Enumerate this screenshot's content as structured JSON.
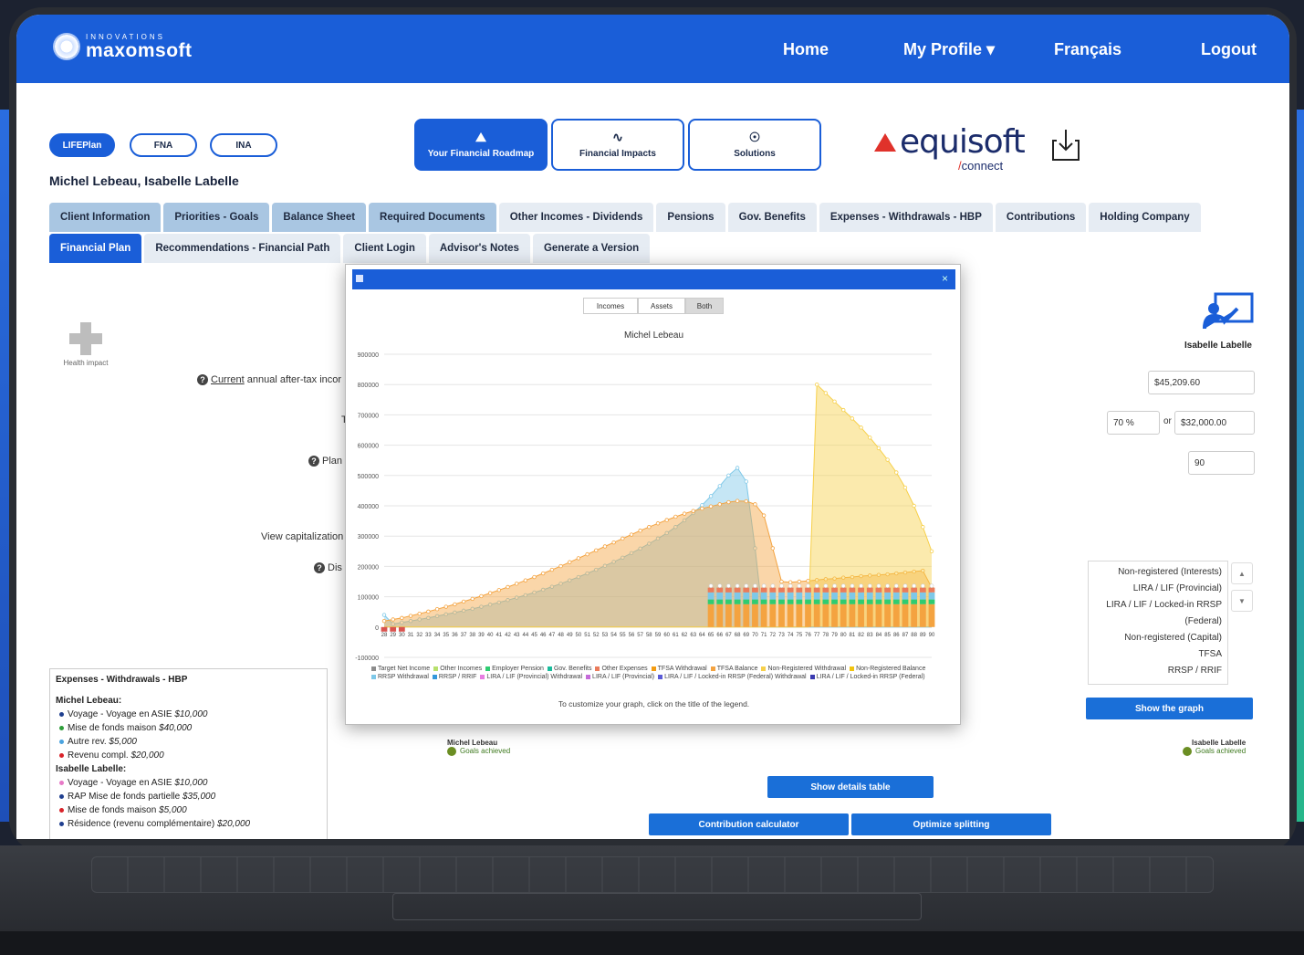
{
  "brand": {
    "small": "INNOVATIONS",
    "name": "maxomsoft"
  },
  "nav": {
    "home": "Home",
    "profile": "My Profile ▾",
    "lang": "Français",
    "logout": "Logout"
  },
  "pills": [
    "LIFEPlan",
    "FNA",
    "INA"
  ],
  "bigtabs": [
    {
      "label": "Your Financial Roadmap",
      "icon": "roadmap-icon"
    },
    {
      "label": "Financial Impacts",
      "icon": "impacts-icon"
    },
    {
      "label": "Solutions",
      "icon": "lightbulb-icon"
    }
  ],
  "equisoft": {
    "name": "equisoft",
    "slash": "/",
    "sub": "connect"
  },
  "client_name": "Michel Lebeau, Isabelle Labelle",
  "tabs_row1": [
    "Client Information",
    "Priorities - Goals",
    "Balance Sheet",
    "Required Documents",
    "Other Incomes - Dividends",
    "Pensions",
    "Gov. Benefits",
    "Expenses - Withdrawals - HBP",
    "Contributions",
    "Holding Company"
  ],
  "tabs_row2": [
    "Financial Plan",
    "Recommendations - Financial Path",
    "Client Login",
    "Advisor's Notes",
    "Generate a Version"
  ],
  "health": "Health impact",
  "labels": {
    "current": "Current",
    "current_rest": " annual after-tax incor",
    "t": "T",
    "plan": "Plan",
    "view_cap": "View capitalization",
    "dis": "Dis"
  },
  "right_panel": {
    "name": "Isabelle Labelle",
    "income": "$45,209.60",
    "pct": "70 %",
    "or": "or",
    "amount": "$32,000.00",
    "age": "90",
    "list": [
      "Non-registered (Interests)",
      "LIRA / LIF (Provincial)",
      "LIRA / LIF / Locked-in RRSP",
      "(Federal)",
      "Non-registered (Capital)",
      "TFSA",
      "RRSP / RRIF"
    ],
    "up": "▲",
    "down": "▼",
    "show_graph": "Show the graph"
  },
  "goals": {
    "michel": "Michel Lebeau",
    "isabelle": "Isabelle Labelle",
    "achieved": "Goals achieved"
  },
  "buttons": {
    "details": "Show details table",
    "contrib": "Contribution calculator",
    "split": "Optimize splitting"
  },
  "expenses": {
    "title": "Expenses - Withdrawals - HBP",
    "michel_label": "Michel Lebeau:",
    "michel": [
      {
        "t": "Voyage - Voyage en ASIE ",
        "v": "$10,000",
        "c": "#1f3f8f"
      },
      {
        "t": "Mise de fonds maison ",
        "v": "$40,000",
        "c": "#2e9e3a"
      },
      {
        "t": "Autre rev. ",
        "v": "$5,000",
        "c": "#4aa3df"
      },
      {
        "t": "Revenu compl. ",
        "v": "$20,000",
        "c": "#d9232a"
      }
    ],
    "isabelle_label": "Isabelle Labelle:",
    "isabelle": [
      {
        "t": "Voyage - Voyage en ASIE ",
        "v": "$10,000",
        "c": "#e77ac7"
      },
      {
        "t": "RAP Mise de fonds partielle ",
        "v": "$35,000",
        "c": "#1f3f8f"
      },
      {
        "t": "Mise de fonds maison ",
        "v": "$5,000",
        "c": "#d9232a"
      },
      {
        "t": "Résidence (revenu complémentaire) ",
        "v": "$20,000",
        "c": "#1f3f8f"
      }
    ]
  },
  "modal": {
    "segs": [
      "Incomes",
      "Assets",
      "Both"
    ],
    "selected": "Both",
    "tip": "To customize your graph, click on the title of the legend."
  },
  "chart_data": {
    "type": "area",
    "title": "Michel Lebeau",
    "ylim": [
      -100000,
      900000
    ],
    "yticks": [
      -100000,
      0,
      100000,
      200000,
      300000,
      400000,
      500000,
      600000,
      700000,
      800000,
      900000
    ],
    "x": [
      28,
      29,
      30,
      31,
      32,
      33,
      34,
      35,
      36,
      37,
      38,
      39,
      40,
      41,
      42,
      43,
      44,
      45,
      46,
      47,
      48,
      49,
      50,
      51,
      52,
      53,
      54,
      55,
      56,
      57,
      58,
      59,
      60,
      61,
      62,
      63,
      64,
      65,
      66,
      67,
      68,
      69,
      70,
      71,
      72,
      73,
      74,
      75,
      76,
      77,
      78,
      79,
      80,
      81,
      82,
      83,
      84,
      85,
      86,
      87,
      88,
      89,
      90
    ],
    "series": [
      {
        "name": "RRSP Withdrawal",
        "color": "#7ec8e8",
        "values": [
          40000,
          10000,
          15000,
          20000,
          25000,
          30000,
          36000,
          42000,
          48000,
          54000,
          60000,
          67000,
          74000,
          81000,
          89000,
          97000,
          105000,
          114000,
          123000,
          133000,
          143000,
          154000,
          165000,
          177000,
          189000,
          202000,
          215000,
          229000,
          244000,
          259000,
          275000,
          292000,
          310000,
          330000,
          352000,
          376000,
          402000,
          432000,
          465000,
          500000,
          525000,
          480000,
          260000,
          0,
          0,
          0,
          0,
          0,
          0,
          0,
          0,
          0,
          0,
          0,
          0,
          0,
          0,
          0,
          0,
          0,
          0,
          0,
          0
        ]
      },
      {
        "name": "TFSA Balance",
        "color": "#f4a340",
        "values": [
          20000,
          25000,
          30000,
          37000,
          44000,
          51000,
          59000,
          67000,
          75000,
          84000,
          93000,
          102000,
          112000,
          122000,
          132000,
          143000,
          154000,
          165000,
          177000,
          189000,
          201000,
          214000,
          227000,
          240000,
          253000,
          266000,
          279000,
          292000,
          305000,
          318000,
          330000,
          342000,
          353000,
          364000,
          374000,
          383000,
          391000,
          398000,
          405000,
          412000,
          416000,
          415000,
          405000,
          368000,
          260000,
          150000,
          148000,
          150000,
          152000,
          155000,
          158000,
          160000,
          163000,
          165000,
          168000,
          170000,
          172000,
          174000,
          177000,
          180000,
          183000,
          186000,
          130000
        ]
      },
      {
        "name": "Non-Registered Balance",
        "color": "#f7d04a",
        "values": [
          0,
          0,
          0,
          0,
          0,
          0,
          0,
          0,
          0,
          0,
          0,
          0,
          0,
          0,
          0,
          0,
          0,
          0,
          0,
          0,
          0,
          0,
          0,
          0,
          0,
          0,
          0,
          0,
          0,
          0,
          0,
          0,
          0,
          0,
          0,
          0,
          0,
          0,
          0,
          0,
          0,
          0,
          0,
          0,
          0,
          0,
          0,
          0,
          0,
          800000,
          772000,
          744000,
          716000,
          688000,
          658000,
          625000,
          590000,
          552000,
          510000,
          460000,
          400000,
          330000,
          250000
        ]
      }
    ],
    "bars": {
      "start_age": 65,
      "total": 130000,
      "colors": [
        "#f4a340",
        "#2ecc71",
        "#7ec8e8",
        "#ea7b5b"
      ]
    },
    "legend": [
      {
        "name": "Target Net Income",
        "color": "#8c8c8c"
      },
      {
        "name": "Other Incomes",
        "color": "#b7e06c"
      },
      {
        "name": "Employer Pension",
        "color": "#2ecc71"
      },
      {
        "name": "Gov. Benefits",
        "color": "#1abc9c"
      },
      {
        "name": "Other Expenses",
        "color": "#ea7b5b"
      },
      {
        "name": "TFSA Withdrawal",
        "color": "#f39c12"
      },
      {
        "name": "TFSA Balance",
        "color": "#f4a340"
      },
      {
        "name": "Non-Registered Withdrawal",
        "color": "#f7d04a"
      },
      {
        "name": "Non-Registered Balance",
        "color": "#f1c40f"
      },
      {
        "name": "RRSP Withdrawal",
        "color": "#7ec8e8"
      },
      {
        "name": "RRSP / RRIF",
        "color": "#3498db"
      },
      {
        "name": "LIRA / LIF (Provincial) Withdrawal",
        "color": "#e67ee0"
      },
      {
        "name": "LIRA / LIF (Provincial)",
        "color": "#c56ad9"
      },
      {
        "name": "LIRA / LIF / Locked-in RRSP (Federal) Withdrawal",
        "color": "#5b5bd6"
      },
      {
        "name": "LIRA / LIF / Locked-in RRSP (Federal)",
        "color": "#3a3ab0"
      }
    ]
  }
}
